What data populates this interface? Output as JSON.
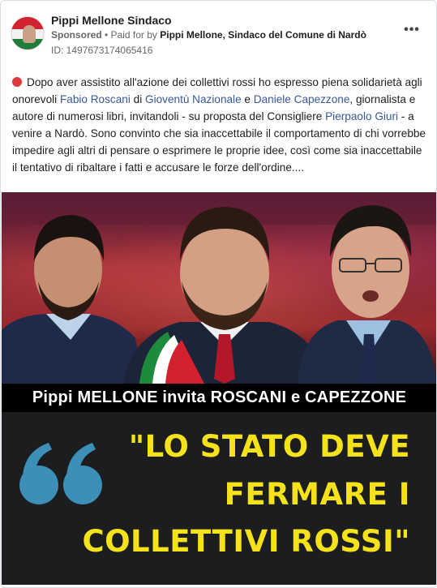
{
  "post": {
    "page_name": "Pippi Mellone Sindaco",
    "sponsored_label": "Sponsored",
    "separator": " • ",
    "paid_for_prefix": "Paid for by ",
    "paid_for_by": "Pippi Mellone, Sindaco del Comune di Nardò",
    "ad_id": "ID: 1497673174065416",
    "more_icon": "more-horizontal-icon",
    "more_label": "•••"
  },
  "text": {
    "p1": "Dopo aver assistito all'azione dei collettivi rossi ho espresso piena solidarietà agli onorevoli ",
    "link_roscani": "Fabio Roscani",
    "p2": " di ",
    "link_gioventu": "Gioventù Nazionale",
    "p3": " e ",
    "link_capezzone": "Daniele Capezzone",
    "p4": ", giornalista e autore di numerosi libri, invitandoli - su proposta del Consigliere ",
    "link_giuri": "Pierpaolo Giuri",
    "p5": " - a venire a Nardò. Sono convinto che sia inaccettabile il comportamento di chi vorrebbe impedire agli altri di pensare o esprimere le proprie idee, così come sia inaccettabile il tentativo di ribaltare i fatti e accusare le forze dell'ordine...."
  },
  "image": {
    "banner": "Pippi MELLONE invita ROSCANI e CAPEZZONE",
    "quote_line1": "\"LO STATO DEVE",
    "quote_line2": "FERMARE I",
    "quote_line3": "COLLETTIVI ROSSI\"",
    "colors": {
      "quote_yellow": "#f5e21b",
      "quote_mark_blue": "#3d8fb8",
      "banner_bg": "#000000",
      "quote_bg": "#1b1d1f"
    }
  }
}
